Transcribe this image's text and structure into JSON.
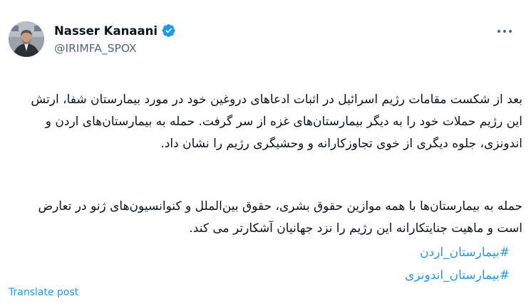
{
  "author": {
    "name": "Nasser Kanaani",
    "handle": "@IRIMFA_SPOX",
    "verified": true,
    "badge_color": "#1d9bf0"
  },
  "post": {
    "paragraph1": "بعد از شکست مقامات رژیم اسرائیل در اثبات ادعاهای دروغین خود در مورد بیمارستان شفا، ارتش این رژیم حملات خود را به دیگر بیمارستان‌های غزه از سر گرفت. حمله به بیمارستان‌های اردن و اندونزی، جلوه دیگری از خوی تجاوزکارانه و وحشیگری رژیم را نشان داد.",
    "paragraph2": "حمله به بیمارستان‌ها با همه موازین حقوق بشری، حقوق بین‌الملل و کنوانسیون‌های ژنو در تعارض است و ماهیت جنایتکارانه این رژیم را نزد جهانیان آشکارتر می کند.",
    "hashtags": [
      "#بیمارستان_اردن",
      "#بیمارستان_اندونزی"
    ],
    "translate_label": "Translate post"
  },
  "icons": {
    "verified": "verified-badge-icon",
    "more": "more-options-icon"
  },
  "colors": {
    "link": "#1d9bf0",
    "text": "#0f1419",
    "secondary": "#536471"
  }
}
